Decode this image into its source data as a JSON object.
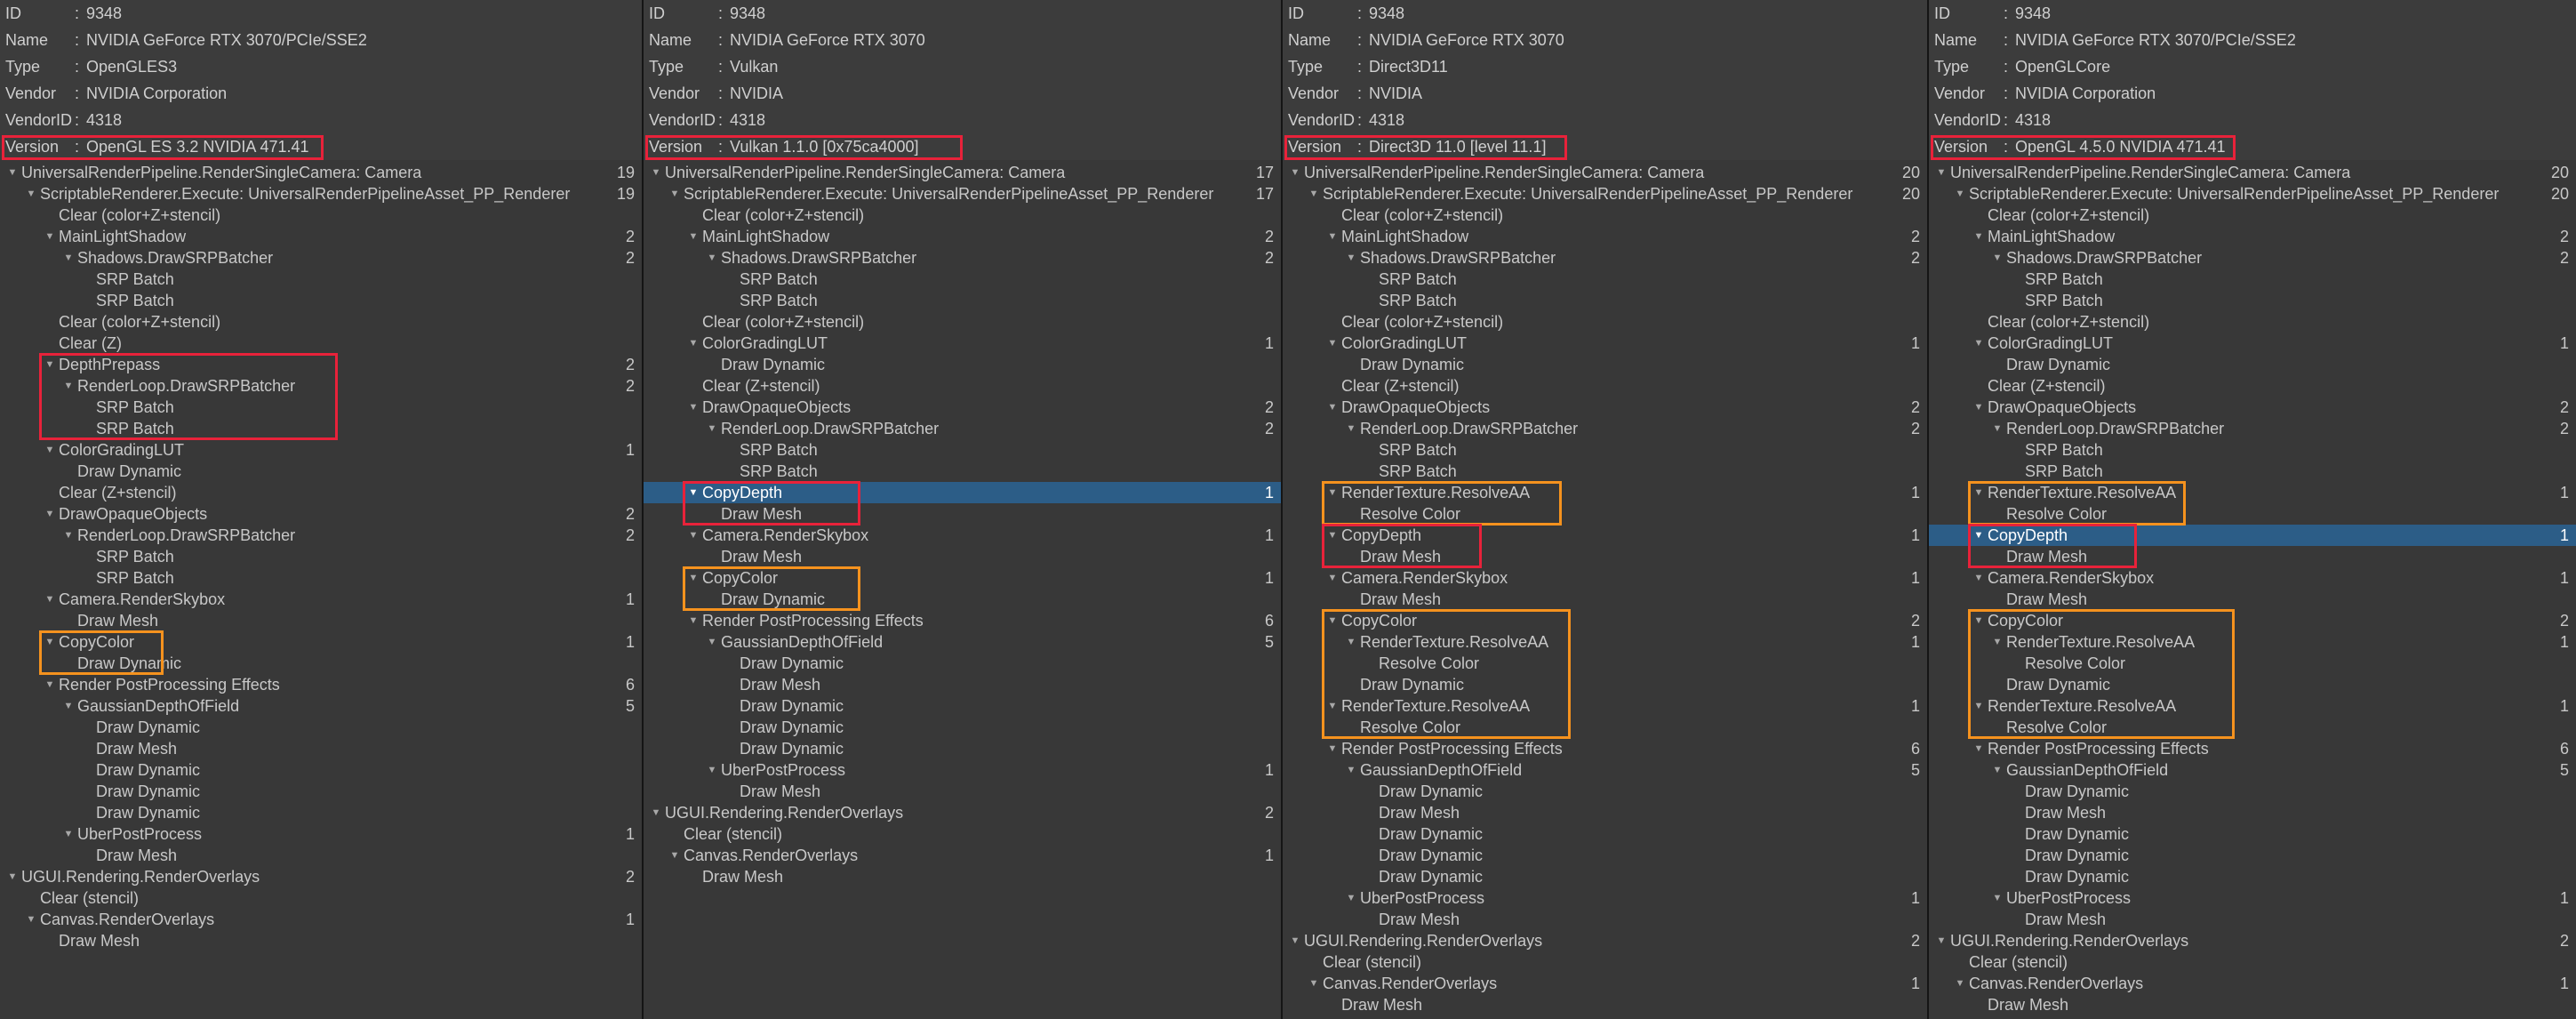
{
  "colors": {
    "background": "#383838",
    "header_background": "#3c3c3c",
    "selection": "#2c5d87",
    "red_highlight": "#e8223a",
    "orange_highlight": "#f5921e"
  },
  "header_labels": {
    "id": "ID",
    "name": "Name",
    "type": "Type",
    "vendor": "Vendor",
    "vendor_id": "VendorID",
    "version": "Version",
    "colon": ":"
  },
  "panels": [
    {
      "info": {
        "id": "9348",
        "name": "NVIDIA GeForce RTX 3070/PCIe/SSE2",
        "type": "OpenGLES3",
        "vendor": "NVIDIA Corporation",
        "vendor_id": "4318",
        "version": "OpenGL ES 3.2 NVIDIA 471.41"
      },
      "rows": [
        {
          "d": 0,
          "e": 1,
          "t": "UniversalRenderPipeline.RenderSingleCamera: Camera",
          "c": "19"
        },
        {
          "d": 1,
          "e": 1,
          "t": "ScriptableRenderer.Execute: UniversalRenderPipelineAsset_PP_Renderer",
          "c": "19"
        },
        {
          "d": 2,
          "e": 0,
          "t": "Clear (color+Z+stencil)",
          "c": ""
        },
        {
          "d": 2,
          "e": 1,
          "t": "MainLightShadow",
          "c": "2"
        },
        {
          "d": 3,
          "e": 1,
          "t": "Shadows.DrawSRPBatcher",
          "c": "2"
        },
        {
          "d": 4,
          "e": 0,
          "t": "SRP Batch",
          "c": ""
        },
        {
          "d": 4,
          "e": 0,
          "t": "SRP Batch",
          "c": ""
        },
        {
          "d": 2,
          "e": 0,
          "t": "Clear (color+Z+stencil)",
          "c": ""
        },
        {
          "d": 2,
          "e": 0,
          "t": "Clear (Z)",
          "c": ""
        },
        {
          "d": 2,
          "e": 1,
          "t": "DepthPrepass",
          "c": "2"
        },
        {
          "d": 3,
          "e": 1,
          "t": "RenderLoop.DrawSRPBatcher",
          "c": "2"
        },
        {
          "d": 4,
          "e": 0,
          "t": "SRP Batch",
          "c": ""
        },
        {
          "d": 4,
          "e": 0,
          "t": "SRP Batch",
          "c": ""
        },
        {
          "d": 2,
          "e": 1,
          "t": "ColorGradingLUT",
          "c": "1"
        },
        {
          "d": 3,
          "e": 0,
          "t": "Draw Dynamic",
          "c": ""
        },
        {
          "d": 2,
          "e": 0,
          "t": "Clear (Z+stencil)",
          "c": ""
        },
        {
          "d": 2,
          "e": 1,
          "t": "DrawOpaqueObjects",
          "c": "2"
        },
        {
          "d": 3,
          "e": 1,
          "t": "RenderLoop.DrawSRPBatcher",
          "c": "2"
        },
        {
          "d": 4,
          "e": 0,
          "t": "SRP Batch",
          "c": ""
        },
        {
          "d": 4,
          "e": 0,
          "t": "SRP Batch",
          "c": ""
        },
        {
          "d": 2,
          "e": 1,
          "t": "Camera.RenderSkybox",
          "c": "1"
        },
        {
          "d": 3,
          "e": 0,
          "t": "Draw Mesh",
          "c": ""
        },
        {
          "d": 2,
          "e": 1,
          "t": "CopyColor",
          "c": "1"
        },
        {
          "d": 3,
          "e": 0,
          "t": "Draw Dynamic",
          "c": ""
        },
        {
          "d": 2,
          "e": 1,
          "t": "Render PostProcessing Effects",
          "c": "6"
        },
        {
          "d": 3,
          "e": 1,
          "t": "GaussianDepthOfField",
          "c": "5"
        },
        {
          "d": 4,
          "e": 0,
          "t": "Draw Dynamic",
          "c": ""
        },
        {
          "d": 4,
          "e": 0,
          "t": "Draw Mesh",
          "c": ""
        },
        {
          "d": 4,
          "e": 0,
          "t": "Draw Dynamic",
          "c": ""
        },
        {
          "d": 4,
          "e": 0,
          "t": "Draw Dynamic",
          "c": ""
        },
        {
          "d": 4,
          "e": 0,
          "t": "Draw Dynamic",
          "c": ""
        },
        {
          "d": 3,
          "e": 1,
          "t": "UberPostProcess",
          "c": "1"
        },
        {
          "d": 4,
          "e": 0,
          "t": "Draw Mesh",
          "c": ""
        },
        {
          "d": 0,
          "e": 1,
          "t": "UGUI.Rendering.RenderOverlays",
          "c": "2"
        },
        {
          "d": 1,
          "e": 0,
          "t": "Clear (stencil)",
          "c": ""
        },
        {
          "d": 1,
          "e": 1,
          "t": "Canvas.RenderOverlays",
          "c": "1"
        },
        {
          "d": 2,
          "e": 0,
          "t": "Draw Mesh",
          "c": ""
        }
      ]
    },
    {
      "info": {
        "id": "9348",
        "name": "NVIDIA GeForce RTX 3070",
        "type": "Vulkan",
        "vendor": "NVIDIA",
        "vendor_id": "4318",
        "version": "Vulkan 1.1.0 [0x75ca4000]"
      },
      "rows": [
        {
          "d": 0,
          "e": 1,
          "t": "UniversalRenderPipeline.RenderSingleCamera: Camera",
          "c": "17"
        },
        {
          "d": 1,
          "e": 1,
          "t": "ScriptableRenderer.Execute: UniversalRenderPipelineAsset_PP_Renderer",
          "c": "17"
        },
        {
          "d": 2,
          "e": 0,
          "t": "Clear (color+Z+stencil)",
          "c": ""
        },
        {
          "d": 2,
          "e": 1,
          "t": "MainLightShadow",
          "c": "2"
        },
        {
          "d": 3,
          "e": 1,
          "t": "Shadows.DrawSRPBatcher",
          "c": "2"
        },
        {
          "d": 4,
          "e": 0,
          "t": "SRP Batch",
          "c": ""
        },
        {
          "d": 4,
          "e": 0,
          "t": "SRP Batch",
          "c": ""
        },
        {
          "d": 2,
          "e": 0,
          "t": "Clear (color+Z+stencil)",
          "c": ""
        },
        {
          "d": 2,
          "e": 1,
          "t": "ColorGradingLUT",
          "c": "1"
        },
        {
          "d": 3,
          "e": 0,
          "t": "Draw Dynamic",
          "c": ""
        },
        {
          "d": 2,
          "e": 0,
          "t": "Clear (Z+stencil)",
          "c": ""
        },
        {
          "d": 2,
          "e": 1,
          "t": "DrawOpaqueObjects",
          "c": "2"
        },
        {
          "d": 3,
          "e": 1,
          "t": "RenderLoop.DrawSRPBatcher",
          "c": "2"
        },
        {
          "d": 4,
          "e": 0,
          "t": "SRP Batch",
          "c": ""
        },
        {
          "d": 4,
          "e": 0,
          "t": "SRP Batch",
          "c": ""
        },
        {
          "d": 2,
          "e": 1,
          "t": "CopyDepth",
          "c": "1",
          "sel": 1
        },
        {
          "d": 3,
          "e": 0,
          "t": "Draw Mesh",
          "c": ""
        },
        {
          "d": 2,
          "e": 1,
          "t": "Camera.RenderSkybox",
          "c": "1"
        },
        {
          "d": 3,
          "e": 0,
          "t": "Draw Mesh",
          "c": ""
        },
        {
          "d": 2,
          "e": 1,
          "t": "CopyColor",
          "c": "1"
        },
        {
          "d": 3,
          "e": 0,
          "t": "Draw Dynamic",
          "c": ""
        },
        {
          "d": 2,
          "e": 1,
          "t": "Render PostProcessing Effects",
          "c": "6"
        },
        {
          "d": 3,
          "e": 1,
          "t": "GaussianDepthOfField",
          "c": "5"
        },
        {
          "d": 4,
          "e": 0,
          "t": "Draw Dynamic",
          "c": ""
        },
        {
          "d": 4,
          "e": 0,
          "t": "Draw Mesh",
          "c": ""
        },
        {
          "d": 4,
          "e": 0,
          "t": "Draw Dynamic",
          "c": ""
        },
        {
          "d": 4,
          "e": 0,
          "t": "Draw Dynamic",
          "c": ""
        },
        {
          "d": 4,
          "e": 0,
          "t": "Draw Dynamic",
          "c": ""
        },
        {
          "d": 3,
          "e": 1,
          "t": "UberPostProcess",
          "c": "1"
        },
        {
          "d": 4,
          "e": 0,
          "t": "Draw Mesh",
          "c": ""
        },
        {
          "d": 0,
          "e": 1,
          "t": "UGUI.Rendering.RenderOverlays",
          "c": "2"
        },
        {
          "d": 1,
          "e": 0,
          "t": "Clear (stencil)",
          "c": ""
        },
        {
          "d": 1,
          "e": 1,
          "t": "Canvas.RenderOverlays",
          "c": "1"
        },
        {
          "d": 2,
          "e": 0,
          "t": "Draw Mesh",
          "c": ""
        }
      ]
    },
    {
      "info": {
        "id": "9348",
        "name": "NVIDIA GeForce RTX 3070",
        "type": "Direct3D11",
        "vendor": "NVIDIA",
        "vendor_id": "4318",
        "version": "Direct3D 11.0 [level 11.1]"
      },
      "rows": [
        {
          "d": 0,
          "e": 1,
          "t": "UniversalRenderPipeline.RenderSingleCamera: Camera",
          "c": "20"
        },
        {
          "d": 1,
          "e": 1,
          "t": "ScriptableRenderer.Execute: UniversalRenderPipelineAsset_PP_Renderer",
          "c": "20"
        },
        {
          "d": 2,
          "e": 0,
          "t": "Clear (color+Z+stencil)",
          "c": ""
        },
        {
          "d": 2,
          "e": 1,
          "t": "MainLightShadow",
          "c": "2"
        },
        {
          "d": 3,
          "e": 1,
          "t": "Shadows.DrawSRPBatcher",
          "c": "2"
        },
        {
          "d": 4,
          "e": 0,
          "t": "SRP Batch",
          "c": ""
        },
        {
          "d": 4,
          "e": 0,
          "t": "SRP Batch",
          "c": ""
        },
        {
          "d": 2,
          "e": 0,
          "t": "Clear (color+Z+stencil)",
          "c": ""
        },
        {
          "d": 2,
          "e": 1,
          "t": "ColorGradingLUT",
          "c": "1"
        },
        {
          "d": 3,
          "e": 0,
          "t": "Draw Dynamic",
          "c": ""
        },
        {
          "d": 2,
          "e": 0,
          "t": "Clear (Z+stencil)",
          "c": ""
        },
        {
          "d": 2,
          "e": 1,
          "t": "DrawOpaqueObjects",
          "c": "2"
        },
        {
          "d": 3,
          "e": 1,
          "t": "RenderLoop.DrawSRPBatcher",
          "c": "2"
        },
        {
          "d": 4,
          "e": 0,
          "t": "SRP Batch",
          "c": ""
        },
        {
          "d": 4,
          "e": 0,
          "t": "SRP Batch",
          "c": ""
        },
        {
          "d": 2,
          "e": 1,
          "t": "RenderTexture.ResolveAA",
          "c": "1"
        },
        {
          "d": 3,
          "e": 0,
          "t": "Resolve Color",
          "c": ""
        },
        {
          "d": 2,
          "e": 1,
          "t": "CopyDepth",
          "c": "1"
        },
        {
          "d": 3,
          "e": 0,
          "t": "Draw Mesh",
          "c": ""
        },
        {
          "d": 2,
          "e": 1,
          "t": "Camera.RenderSkybox",
          "c": "1"
        },
        {
          "d": 3,
          "e": 0,
          "t": "Draw Mesh",
          "c": ""
        },
        {
          "d": 2,
          "e": 1,
          "t": "CopyColor",
          "c": "2"
        },
        {
          "d": 3,
          "e": 1,
          "t": "RenderTexture.ResolveAA",
          "c": "1"
        },
        {
          "d": 4,
          "e": 0,
          "t": "Resolve Color",
          "c": ""
        },
        {
          "d": 3,
          "e": 0,
          "t": "Draw Dynamic",
          "c": ""
        },
        {
          "d": 2,
          "e": 1,
          "t": "RenderTexture.ResolveAA",
          "c": "1"
        },
        {
          "d": 3,
          "e": 0,
          "t": "Resolve Color",
          "c": ""
        },
        {
          "d": 2,
          "e": 1,
          "t": "Render PostProcessing Effects",
          "c": "6"
        },
        {
          "d": 3,
          "e": 1,
          "t": "GaussianDepthOfField",
          "c": "5"
        },
        {
          "d": 4,
          "e": 0,
          "t": "Draw Dynamic",
          "c": ""
        },
        {
          "d": 4,
          "e": 0,
          "t": "Draw Mesh",
          "c": ""
        },
        {
          "d": 4,
          "e": 0,
          "t": "Draw Dynamic",
          "c": ""
        },
        {
          "d": 4,
          "e": 0,
          "t": "Draw Dynamic",
          "c": ""
        },
        {
          "d": 4,
          "e": 0,
          "t": "Draw Dynamic",
          "c": ""
        },
        {
          "d": 3,
          "e": 1,
          "t": "UberPostProcess",
          "c": "1"
        },
        {
          "d": 4,
          "e": 0,
          "t": "Draw Mesh",
          "c": ""
        },
        {
          "d": 0,
          "e": 1,
          "t": "UGUI.Rendering.RenderOverlays",
          "c": "2"
        },
        {
          "d": 1,
          "e": 0,
          "t": "Clear (stencil)",
          "c": ""
        },
        {
          "d": 1,
          "e": 1,
          "t": "Canvas.RenderOverlays",
          "c": "1"
        },
        {
          "d": 2,
          "e": 0,
          "t": "Draw Mesh",
          "c": ""
        }
      ]
    },
    {
      "info": {
        "id": "9348",
        "name": "NVIDIA GeForce RTX 3070/PCIe/SSE2",
        "type": "OpenGLCore",
        "vendor": "NVIDIA Corporation",
        "vendor_id": "4318",
        "version": "OpenGL 4.5.0 NVIDIA 471.41"
      },
      "rows": [
        {
          "d": 0,
          "e": 1,
          "t": "UniversalRenderPipeline.RenderSingleCamera: Camera",
          "c": "20"
        },
        {
          "d": 1,
          "e": 1,
          "t": "ScriptableRenderer.Execute: UniversalRenderPipelineAsset_PP_Renderer",
          "c": "20"
        },
        {
          "d": 2,
          "e": 0,
          "t": "Clear (color+Z+stencil)",
          "c": ""
        },
        {
          "d": 2,
          "e": 1,
          "t": "MainLightShadow",
          "c": "2"
        },
        {
          "d": 3,
          "e": 1,
          "t": "Shadows.DrawSRPBatcher",
          "c": "2"
        },
        {
          "d": 4,
          "e": 0,
          "t": "SRP Batch",
          "c": ""
        },
        {
          "d": 4,
          "e": 0,
          "t": "SRP Batch",
          "c": ""
        },
        {
          "d": 2,
          "e": 0,
          "t": "Clear (color+Z+stencil)",
          "c": ""
        },
        {
          "d": 2,
          "e": 1,
          "t": "ColorGradingLUT",
          "c": "1"
        },
        {
          "d": 3,
          "e": 0,
          "t": "Draw Dynamic",
          "c": ""
        },
        {
          "d": 2,
          "e": 0,
          "t": "Clear (Z+stencil)",
          "c": ""
        },
        {
          "d": 2,
          "e": 1,
          "t": "DrawOpaqueObjects",
          "c": "2"
        },
        {
          "d": 3,
          "e": 1,
          "t": "RenderLoop.DrawSRPBatcher",
          "c": "2"
        },
        {
          "d": 4,
          "e": 0,
          "t": "SRP Batch",
          "c": ""
        },
        {
          "d": 4,
          "e": 0,
          "t": "SRP Batch",
          "c": ""
        },
        {
          "d": 2,
          "e": 1,
          "t": "RenderTexture.ResolveAA",
          "c": "1"
        },
        {
          "d": 3,
          "e": 0,
          "t": "Resolve Color",
          "c": ""
        },
        {
          "d": 2,
          "e": 1,
          "t": "CopyDepth",
          "c": "1",
          "sel": 1
        },
        {
          "d": 3,
          "e": 0,
          "t": "Draw Mesh",
          "c": ""
        },
        {
          "d": 2,
          "e": 1,
          "t": "Camera.RenderSkybox",
          "c": "1"
        },
        {
          "d": 3,
          "e": 0,
          "t": "Draw Mesh",
          "c": ""
        },
        {
          "d": 2,
          "e": 1,
          "t": "CopyColor",
          "c": "2"
        },
        {
          "d": 3,
          "e": 1,
          "t": "RenderTexture.ResolveAA",
          "c": "1"
        },
        {
          "d": 4,
          "e": 0,
          "t": "Resolve Color",
          "c": ""
        },
        {
          "d": 3,
          "e": 0,
          "t": "Draw Dynamic",
          "c": ""
        },
        {
          "d": 2,
          "e": 1,
          "t": "RenderTexture.ResolveAA",
          "c": "1"
        },
        {
          "d": 3,
          "e": 0,
          "t": "Resolve Color",
          "c": ""
        },
        {
          "d": 2,
          "e": 1,
          "t": "Render PostProcessing Effects",
          "c": "6"
        },
        {
          "d": 3,
          "e": 1,
          "t": "GaussianDepthOfField",
          "c": "5"
        },
        {
          "d": 4,
          "e": 0,
          "t": "Draw Dynamic",
          "c": ""
        },
        {
          "d": 4,
          "e": 0,
          "t": "Draw Mesh",
          "c": ""
        },
        {
          "d": 4,
          "e": 0,
          "t": "Draw Dynamic",
          "c": ""
        },
        {
          "d": 4,
          "e": 0,
          "t": "Draw Dynamic",
          "c": ""
        },
        {
          "d": 4,
          "e": 0,
          "t": "Draw Dynamic",
          "c": ""
        },
        {
          "d": 3,
          "e": 1,
          "t": "UberPostProcess",
          "c": "1"
        },
        {
          "d": 4,
          "e": 0,
          "t": "Draw Mesh",
          "c": ""
        },
        {
          "d": 0,
          "e": 1,
          "t": "UGUI.Rendering.RenderOverlays",
          "c": "2"
        },
        {
          "d": 1,
          "e": 0,
          "t": "Clear (stencil)",
          "c": ""
        },
        {
          "d": 1,
          "e": 1,
          "t": "Canvas.RenderOverlays",
          "c": "1"
        },
        {
          "d": 2,
          "e": 0,
          "t": "Draw Mesh",
          "c": ""
        }
      ]
    }
  ]
}
